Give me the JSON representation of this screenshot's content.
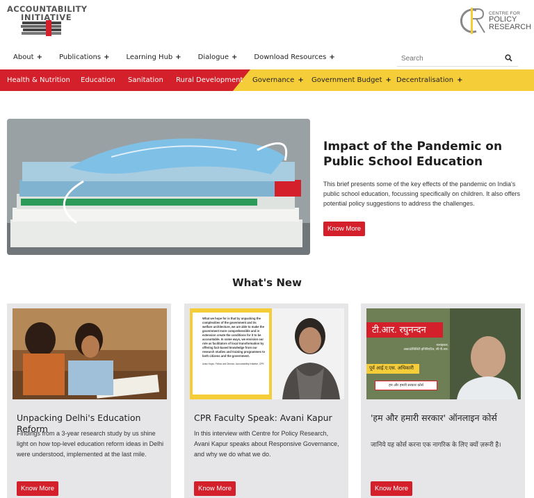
{
  "header": {
    "logo_left_line1": "ACCOUNTABILITY",
    "logo_left_line2": "INITIATIVE",
    "logo_right_small": "CENTRE FOR",
    "logo_right_line1": "POLICY",
    "logo_right_line2": "RESEARCH"
  },
  "nav": {
    "items": [
      {
        "label": "About"
      },
      {
        "label": "Publications"
      },
      {
        "label": "Learning Hub"
      },
      {
        "label": "Dialogue"
      },
      {
        "label": "Download Resources"
      }
    ],
    "plus": "+",
    "search_placeholder": "Search"
  },
  "categories": {
    "red": [
      "Health & Nutrition",
      "Education",
      "Sanitation",
      "Rural Development"
    ],
    "yellow": [
      "Governance",
      "Government Budget",
      "Decentralisation"
    ],
    "colors": {
      "red": "#d4202a",
      "yellow": "#f5cd38"
    }
  },
  "hero": {
    "title": "Impact of the Pandemic on Public School Education",
    "text": "This brief presents some of the key effects of the pandemic on India's public school education, focussing specifically on children. It also offers potential policy suggestions to address the challenges.",
    "button": "Know More"
  },
  "whats_new": {
    "heading": "What's New",
    "cards": [
      {
        "title": "Unpacking Delhi's Education Reform",
        "text": "Findings from a 3-year research study by us shine light on how top-level education reform ideas in Delhi were understood, implemented at the last mile.",
        "button": "Know More"
      },
      {
        "title": "CPR Faculty Speak: Avani Kapur",
        "text": "In this interview with Centre for Policy Research, Avani Kapur speaks about Responsive Governance, and why we do what we do.",
        "button": "Know More",
        "quote": "What we hope for is that by unpacking the complexities of the government and its welfare architecture, we are able to make the government more comprehensible and in extension create the conditions for it to be accountable. In some ways, we envision our role as facilitators of local transformation by offering fact-based knowledge from our research studies and training programmes to both citizens and the government.",
        "quote_author": "Avani Kapur, Fellow and Director, Accountability Initiative, CPR"
      },
      {
        "title": "'हम और हमारी सरकार' ऑनलाइन कोर्स",
        "text": "जानिये यह कोर्स करना एक नागरिक के लिए क्यों ज़रूरी है।",
        "button": "Know More",
        "image_name": "टी.आर. रघुनन्दन",
        "image_sub1": "सलाहकार,",
        "image_sub2": "अकाउंटेबिलिटी इनिशिएटिव, सी.पी.आर.",
        "image_sub3": "पूर्व आई.ए.एस. अधिकारी",
        "image_box": "हम और हमारी सरकार कोर्स"
      }
    ]
  }
}
